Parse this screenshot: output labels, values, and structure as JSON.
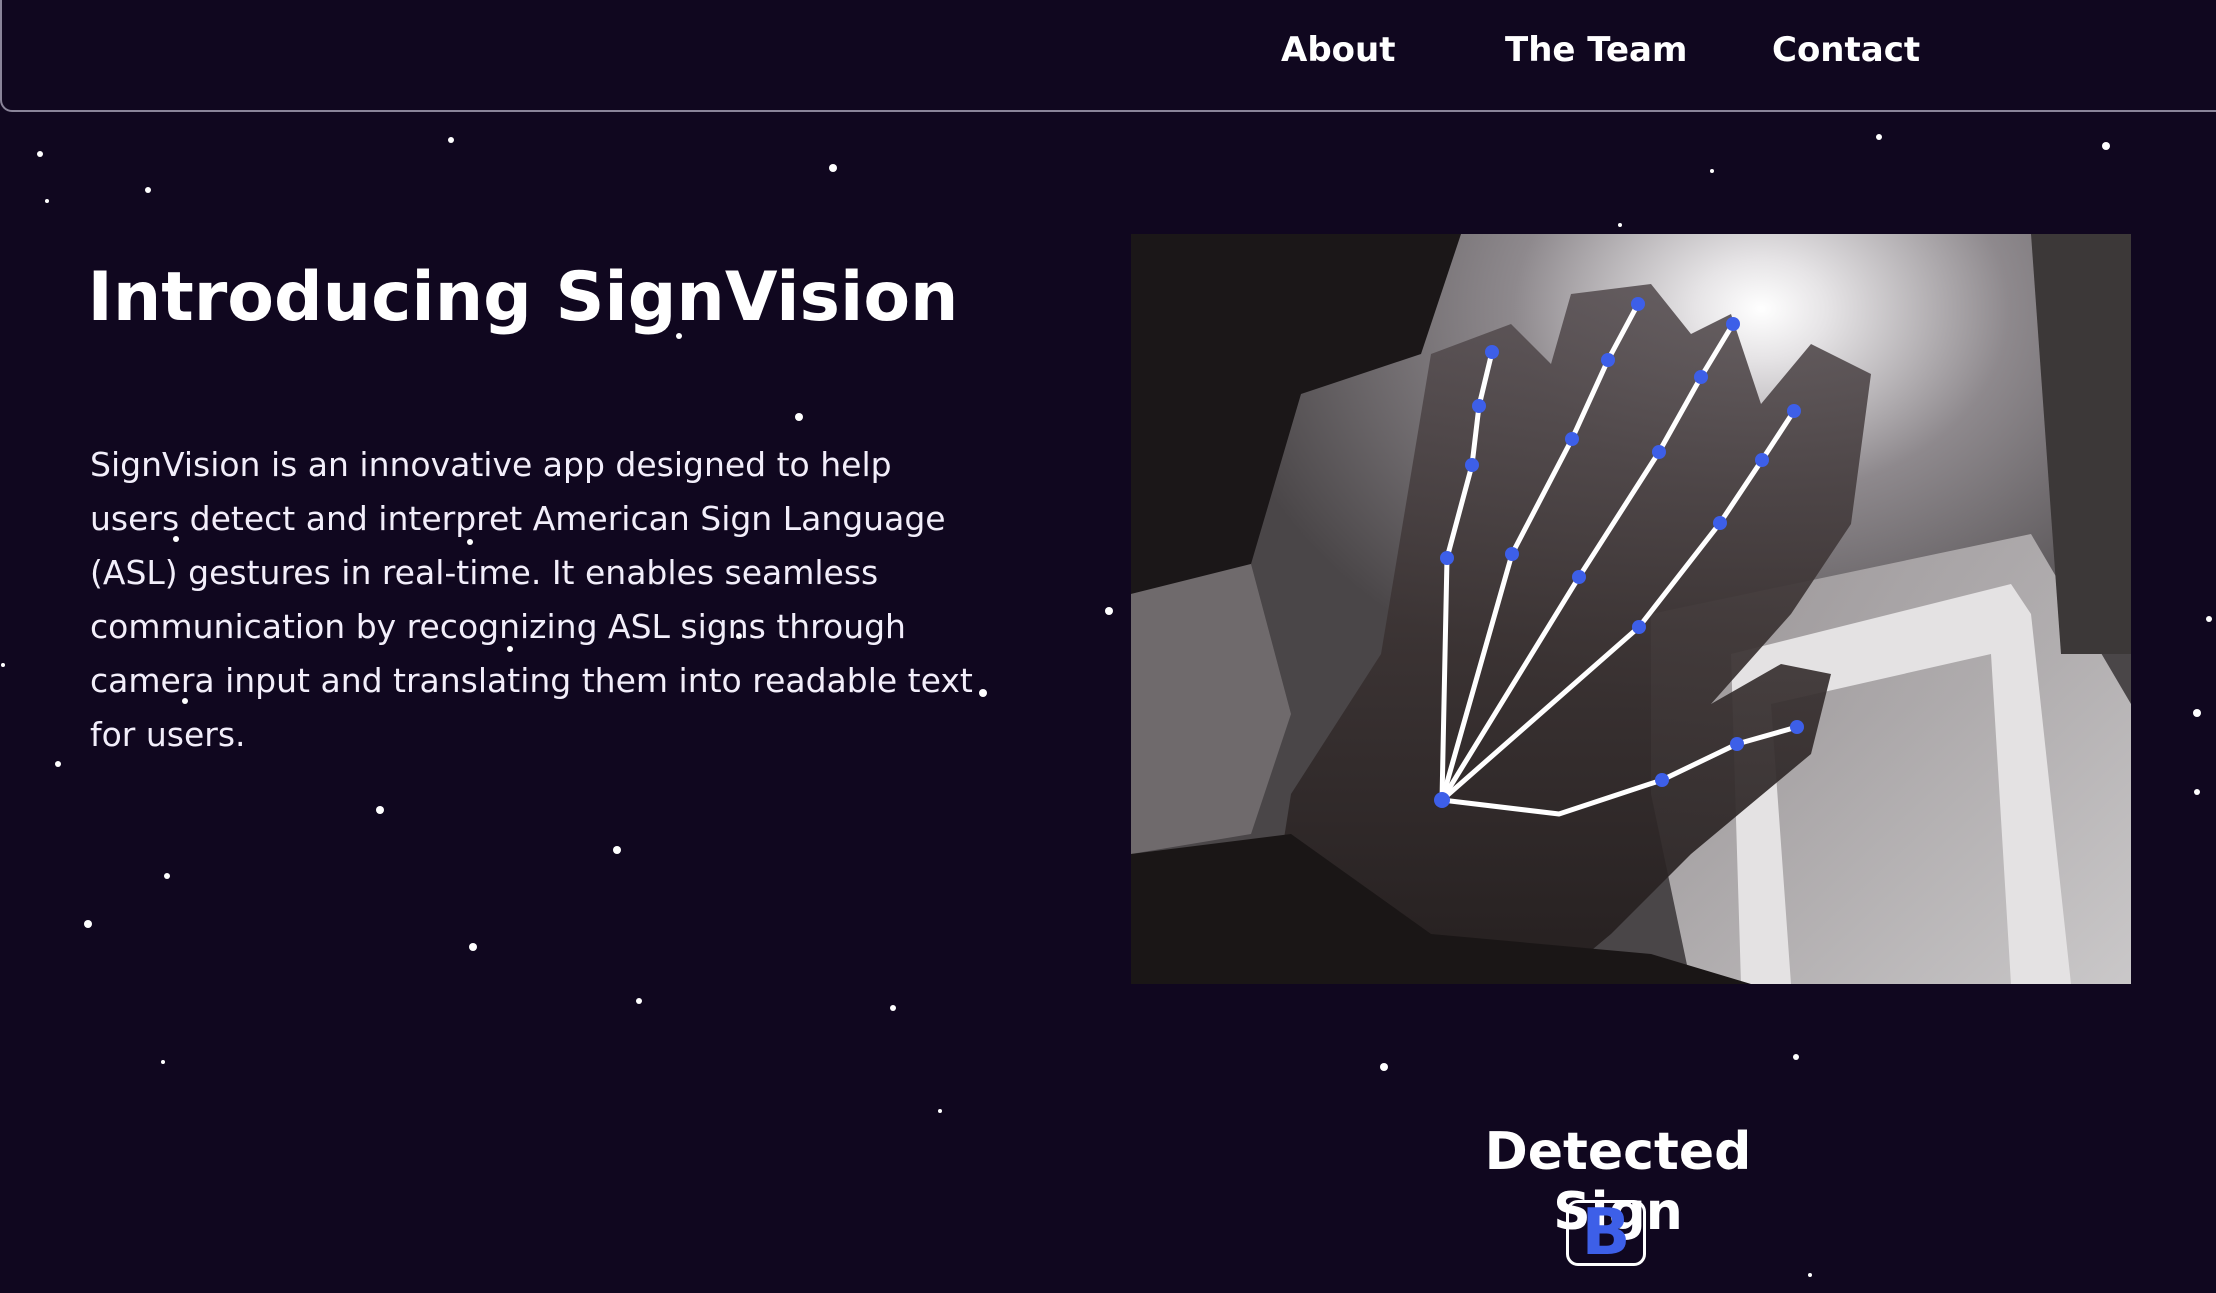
{
  "nav": {
    "items": [
      {
        "label": "About"
      },
      {
        "label": "The Team"
      },
      {
        "label": "Contact"
      }
    ]
  },
  "hero": {
    "title": "Introducing SignVision",
    "description": "SignVision is an innovative app designed to help users detect and interpret American Sign Language (ASL) gestures in real-time. It enables seamless communication by recognizing ASL signs through camera input and translating them into readable text for users."
  },
  "detection": {
    "heading": "Detected Sign",
    "letter": "B"
  },
  "colors": {
    "background": "#10071f",
    "landmark": "#3d5fe8",
    "skeleton": "#ffffff",
    "text": "#ffffff"
  }
}
